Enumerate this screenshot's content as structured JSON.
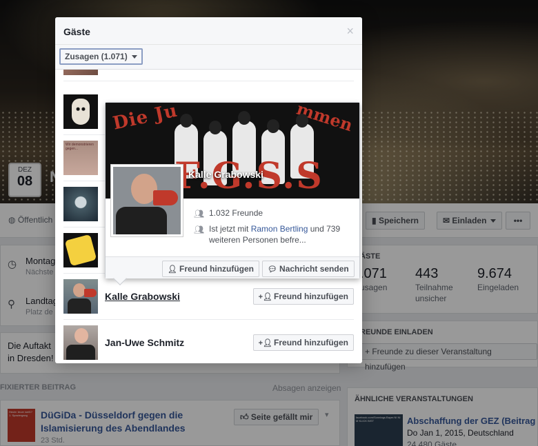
{
  "background": {
    "date": {
      "month": "DEZ",
      "day": "08"
    },
    "title_fragment": "N",
    "public_label": "Öffentlich",
    "save_button": "Speichern",
    "invite_button": "Einladen",
    "more_button": "•••",
    "details": [
      {
        "line1": "Montag",
        "line2": "Nächste"
      },
      {
        "line1": "Landtag",
        "line2": "Platz de"
      }
    ],
    "description": "Die Auftakt\nin Dresden!",
    "pinned_label": "FIXIERTER BEITRAG",
    "absagen_link": "Absagen anzeigen",
    "pinned_post": {
      "title": "DüGiDa - Düsseldorf gegen die Islamisierung des Abendlandes",
      "time": "23 Std.",
      "like_button": "Seite gefällt mir",
      "thumb_text": "Heute: teuer weiß? 1. Spaziergang"
    },
    "stats": {
      "heading": "ÄSTE",
      "items": [
        {
          "number": ".071",
          "label": "usagen"
        },
        {
          "number": "443",
          "label": "Teilnahme unsicher"
        },
        {
          "number": "9.674",
          "label": "Eingeladen"
        }
      ]
    },
    "invite_section": {
      "heading": "REUNDE EINLADEN",
      "button": "+ Freunde zu dieser Veranstaltung hinzufügen"
    },
    "similar": {
      "heading": "ÄHNLICHE VERANSTALTUNGEN",
      "title": "Abschaffung der GEZ (Beitrag",
      "date": "Do Jan 1, 2015, Deutschland",
      "guests": "24.480 Gäste",
      "thumb_text": "facebook.com/Sonntags.Bayer.NI NI M KLICK BIST"
    }
  },
  "modal": {
    "title": "Gäste",
    "close": "×",
    "filter": "Zusagen (1.071)",
    "guests": [
      {
        "name": "Kalle Grabowski",
        "button": "Freund hinzufügen",
        "hover": true
      },
      {
        "name": "Jan-Uwe Schmitz",
        "button": "Freund hinzufügen",
        "hover": false
      }
    ],
    "thumb_texts": [
      "Wir demonstrieren gegen..."
    ]
  },
  "hovercard": {
    "name": "Kalle Grabowski",
    "cover_text_left": "Die Ju",
    "cover_text_right": "mmen",
    "cover_text_big": "F.G.S.S",
    "friends": "1.032 Freunde",
    "mutual_prefix": "Ist jetzt mit ",
    "mutual_link": "Ramon Bertling",
    "mutual_suffix": " und 739 weiteren Personen befre...",
    "add_friend": "Freund hinzufügen",
    "send_message": "Nachricht senden"
  },
  "colors": {
    "link": "#365899",
    "accent_border": "#8b9dc3",
    "overlay": "rgba(0,0,0,0.4)"
  }
}
